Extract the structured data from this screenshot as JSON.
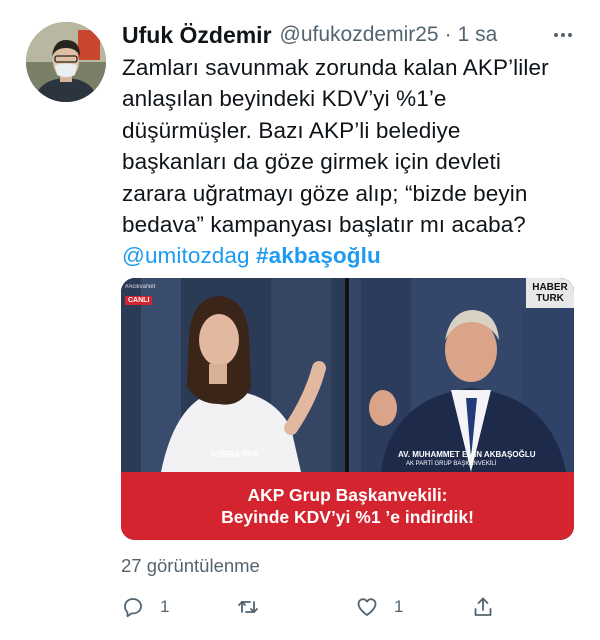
{
  "tweet": {
    "author": {
      "display_name": "Ufuk Özdemir",
      "handle": "@ufukozdemir25",
      "separator": "·",
      "time": "1 sa"
    },
    "text_lines": [
      "Zamları savunmak zorunda kalan AKP’liler",
      "anlaşılan beyindeki KDV’yi %1’e",
      "düşürmüşler. Bazı AKP’li belediye",
      "başkanları da göze girmek için devleti",
      "zarara uğratmayı göze alıp; “bizde beyin",
      "bedava” kampanyası başlatır mı acaba?"
    ],
    "mention": "@umitozdag",
    "hashtag": "#akbaşoğlu",
    "media": {
      "channel_tag": "#AcikvaNet",
      "live_badge": "CANLI",
      "logo_line1": "HABER",
      "logo_line2": "TURK",
      "left_name": "KÜBRA PAR",
      "right_name": "AV. MUHAMMET EMİN AKBAŞOĞLU",
      "right_title": "AK PARTİ GRUP BAŞKANVEKİLİ",
      "caption_line1": "AKP Grup Başkanvekili:",
      "caption_line2": "Beyinde KDV’yi %1 ’e indirdik!"
    },
    "views": "27 görüntülenme",
    "actions": {
      "reply_icon": "reply-icon",
      "reply_count": "1",
      "retweet_icon": "retweet-icon",
      "retweet_count": "",
      "like_icon": "heart-icon",
      "like_count": "1",
      "share_icon": "share-icon"
    },
    "colors": {
      "link": "#1d9bf0",
      "muted": "#536471",
      "caption_red": "#d42430"
    }
  }
}
